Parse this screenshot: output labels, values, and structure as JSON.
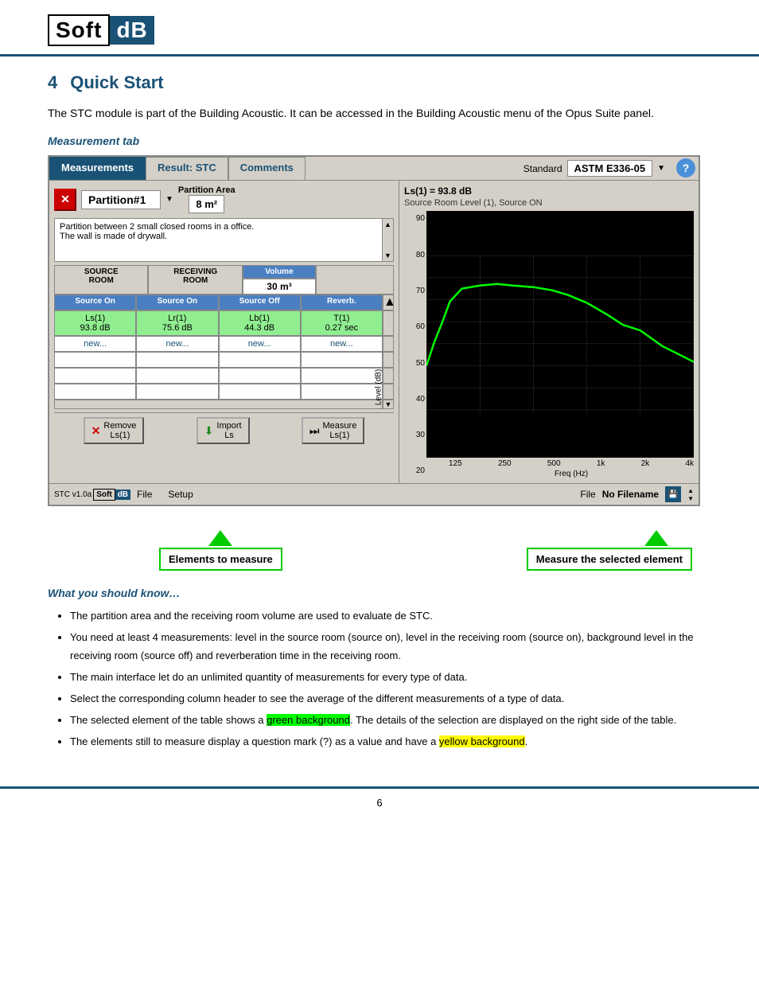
{
  "header": {
    "logo_soft": "Soft",
    "logo_db": "dB"
  },
  "section": {
    "number": "4",
    "title": "Quick Start",
    "paragraph": "The STC module is part of the Building Acoustic. It can be accessed in the Building Acoustic menu of the Opus Suite panel."
  },
  "measurement_tab_heading": "Measurement tab",
  "ui": {
    "tabs": {
      "measurements": "Measurements",
      "result": "Result: STC",
      "comments": "Comments",
      "standard_label": "Standard",
      "standard_value": "ASTM E336-05"
    },
    "partition": {
      "name": "Partition#1",
      "area_label": "Partition Area",
      "area_value": "8 m²",
      "description": "Partition between 2 small closed rooms in a office.\nThe wall is made of drywall."
    },
    "columns": {
      "source_room": "SOURCE\nROOM",
      "receiving_room": "RECEIVING\nROOM",
      "volume_label": "Volume",
      "volume_value": "30 m³"
    },
    "sub_columns": [
      "Source On",
      "Source On",
      "Source Off",
      "Reverb."
    ],
    "data_row1": {
      "ls1": "Ls(1)\n93.8 dB",
      "lr1": "Lr(1)\n75.6 dB",
      "lb1": "Lb(1)\n44.3 dB",
      "t1": "T(1)\n0.27 sec"
    },
    "data_row2": {
      "ls": "new...",
      "lr": "new...",
      "lb": "new...",
      "t": "new..."
    },
    "chart": {
      "title": "Ls(1) = 93.8 dB",
      "subtitle": "Source Room Level (1), Source ON",
      "y_label": "Level (dB)",
      "x_label": "Freq (Hz)",
      "y_ticks": [
        "90",
        "80",
        "70",
        "60",
        "50",
        "40",
        "30",
        "20"
      ],
      "x_ticks": [
        "125",
        "250",
        "500",
        "1k",
        "2k",
        "4k"
      ]
    },
    "action_buttons": {
      "remove": "Remove\nLs(1)",
      "import": "Import\nLs",
      "measure": "Measure\nLs(1)"
    },
    "footer": {
      "version": "STC v1.0a",
      "menu": [
        "File",
        "Setup"
      ],
      "file_label": "File",
      "filename": "No Filename"
    }
  },
  "callouts": {
    "left": "Elements to\nmeasure",
    "right": "Measure the\nselected element"
  },
  "what_section": {
    "heading": "What you should know…",
    "bullets": [
      "The partition area and the receiving room volume are used to evaluate de STC.",
      "You need at least 4 measurements: level in the source room (source on), level in the receiving room (source on), background level in the receiving room (source off) and reverberation time in the receiving room.",
      "The main interface let do an unlimited quantity of measurements for every type of data.",
      "Select the corresponding column header to see the average of the different measurements of a type of data.",
      "The selected element of the table shows a green background. The details of the selection are displayed on the right side of the table.",
      "The elements still to measure display a question mark (?) as a value and have a yellow background."
    ],
    "green_text": "green background",
    "yellow_text": "yellow background"
  },
  "page_number": "6"
}
